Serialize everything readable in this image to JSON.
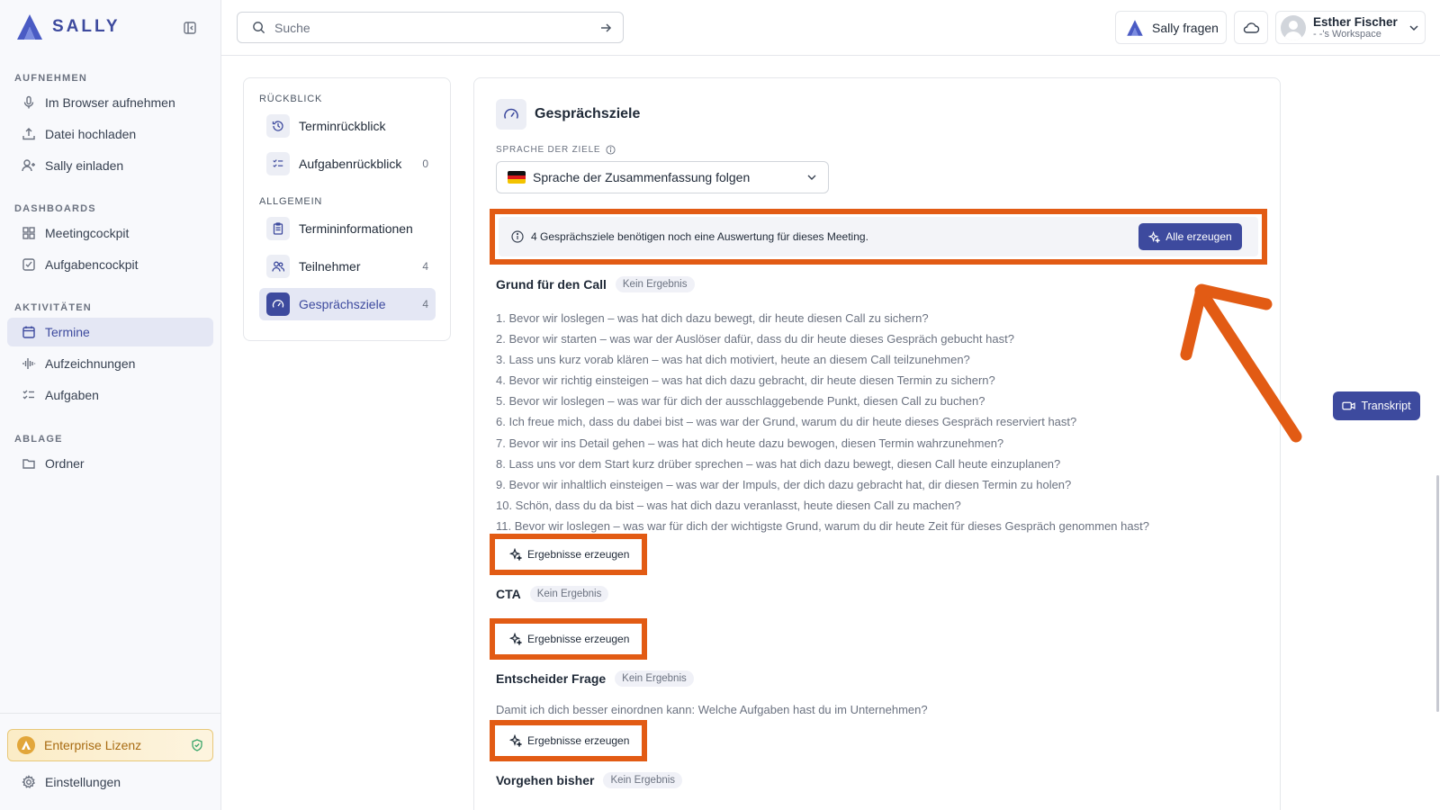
{
  "app": {
    "logo_text": "SALLY",
    "accent_color": "#3d4a9e",
    "highlight_color": "#e25b14"
  },
  "sidebar": {
    "sections": {
      "record": "AUFNEHMEN",
      "dashboards": "DASHBOARDS",
      "activities": "AKTIVITÄTEN",
      "storage": "ABLAGE"
    },
    "items": [
      {
        "label": "Im Browser aufnehmen",
        "icon": "microphone-icon"
      },
      {
        "label": "Datei hochladen",
        "icon": "upload-icon"
      },
      {
        "label": "Sally einladen",
        "icon": "user-plus-icon"
      },
      {
        "label": "Meetingcockpit",
        "icon": "grid-icon"
      },
      {
        "label": "Aufgabencockpit",
        "icon": "checkbox-icon"
      },
      {
        "label": "Termine",
        "icon": "calendar-icon",
        "active": true
      },
      {
        "label": "Aufzeichnungen",
        "icon": "waveform-icon"
      },
      {
        "label": "Aufgaben",
        "icon": "checklist-icon"
      },
      {
        "label": "Ordner",
        "icon": "folder-icon"
      }
    ],
    "license": "Enterprise Lizenz",
    "settings": "Einstellungen"
  },
  "topbar": {
    "search_placeholder": "Suche",
    "ask_sally": "Sally fragen",
    "user_name": "Esther Fischer",
    "workspace": "- -'s Workspace"
  },
  "subnav": {
    "review_title": "RÜCKBLICK",
    "general_title": "ALLGEMEIN",
    "items": [
      {
        "label": "Terminrückblick",
        "count": ""
      },
      {
        "label": "Aufgabenrückblick",
        "count": "0"
      },
      {
        "label": "Termininformationen",
        "count": ""
      },
      {
        "label": "Teilnehmer",
        "count": "4"
      },
      {
        "label": "Gesprächsziele",
        "count": "4",
        "active": true
      }
    ]
  },
  "main": {
    "title": "Gesprächsziele",
    "language_label": "SPRACHE DER ZIELE",
    "language_value": "Sprache der Zusammenfassung folgen",
    "notice": "4 Gesprächsziele benötigen noch eine Auswertung für dieses Meeting.",
    "generate_all": "Alle erzeugen",
    "generate_results": "Ergebnisse erzeugen",
    "no_result": "Kein Ergebnis",
    "goals": [
      {
        "title": "Grund für den Call"
      },
      {
        "title": "CTA"
      },
      {
        "title": "Entscheider Frage",
        "description": "Damit ich dich besser einordnen kann: Welche Aufgaben hast du im Unternehmen?"
      },
      {
        "title": "Vorgehen bisher"
      }
    ],
    "questions": [
      "1. Bevor wir loslegen – was hat dich dazu bewegt, dir heute diesen Call zu sichern?",
      "2. Bevor wir starten – was war der Auslöser dafür, dass du dir heute dieses Gespräch gebucht hast?",
      "3. Lass uns kurz vorab klären – was hat dich motiviert, heute an diesem Call teilzunehmen?",
      "4. Bevor wir richtig einsteigen – was hat dich dazu gebracht, dir heute diesen Termin zu sichern?",
      "5. Bevor wir loslegen – was war für dich der ausschlaggebende Punkt, diesen Call zu buchen?",
      "6. Ich freue mich, dass du dabei bist – was war der Grund, warum du dir heute dieses Gespräch reserviert hast?",
      "7. Bevor wir ins Detail gehen – was hat dich heute dazu bewogen, diesen Termin wahrzunehmen?",
      "8. Lass uns vor dem Start kurz drüber sprechen – was hat dich dazu bewegt, diesen Call heute einzuplanen?",
      "9. Bevor wir inhaltlich einsteigen – was war der Impuls, der dich dazu gebracht hat, dir diesen Termin zu holen?",
      "10. Schön, dass du da bist – was hat dich dazu veranlasst, heute diesen Call zu machen?",
      "11. Bevor wir loslegen – was war für dich der wichtigste Grund, warum du dir heute Zeit für dieses Gespräch genommen hast?"
    ]
  },
  "floating": {
    "transcript": "Transkript"
  }
}
